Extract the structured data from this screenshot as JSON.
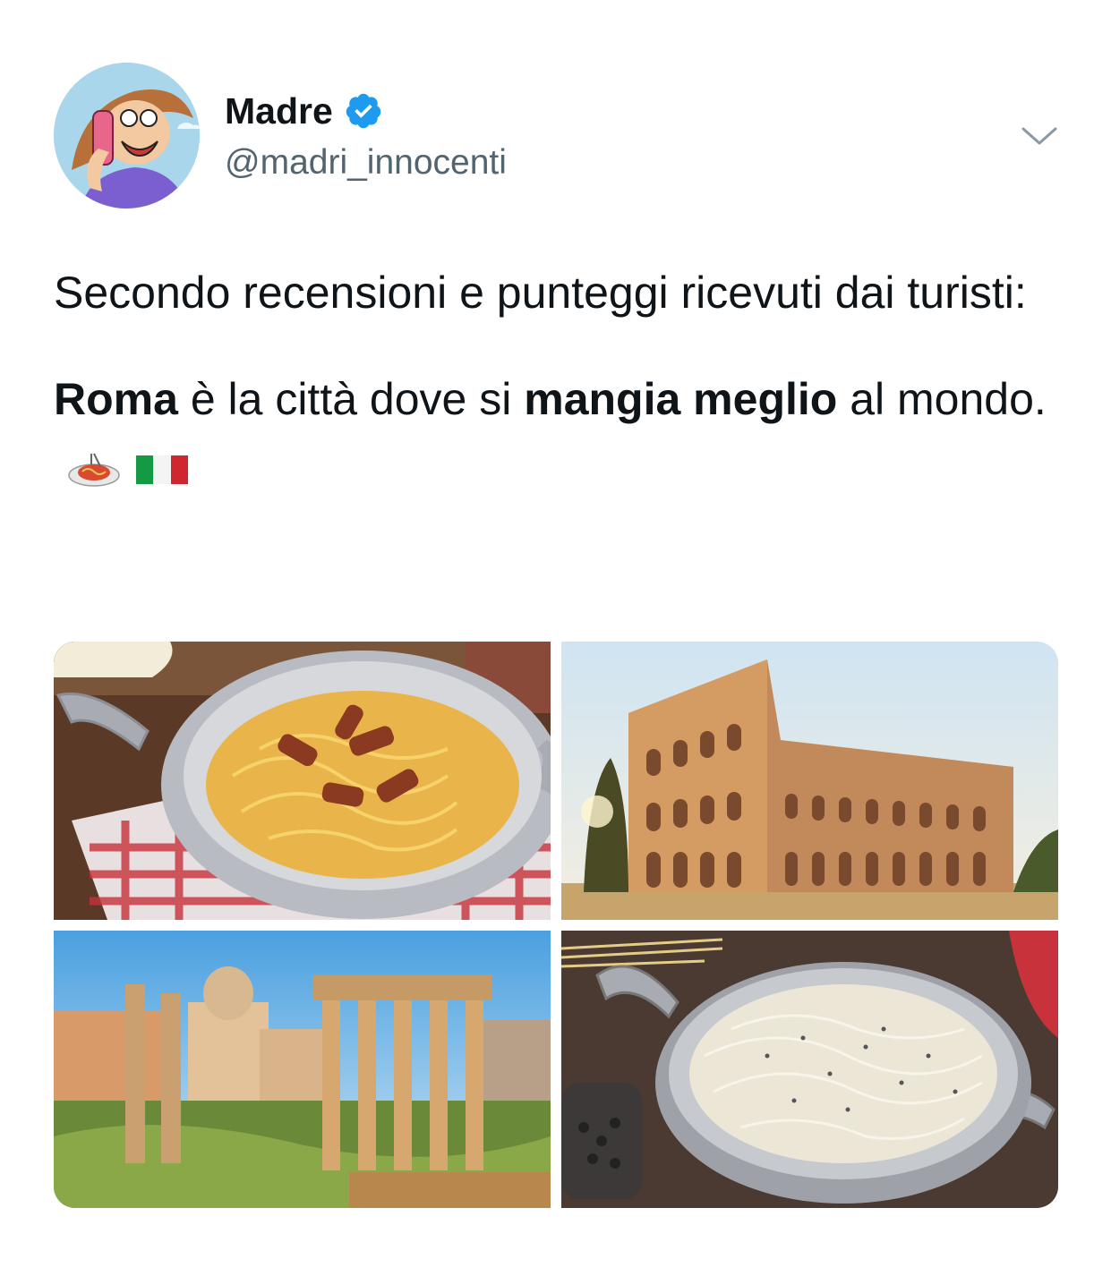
{
  "user": {
    "name": "Madre",
    "handle": "@madri_innocenti",
    "verified": true
  },
  "tweet": {
    "line1": "Secondo recensioni e punteggi ricevuti dai turisti:",
    "line2_bold_1": "Roma",
    "line2_text_1": " è la città dove si ",
    "line2_bold_2": "mangia meglio",
    "line2_text_2": " al mondo.",
    "emojis": [
      "spaghetti-icon",
      "italy-flag-icon"
    ]
  },
  "media": {
    "images": [
      {
        "name": "carbonara-photo"
      },
      {
        "name": "colosseum-photo"
      },
      {
        "name": "roman-forum-photo"
      },
      {
        "name": "cacio-e-pepe-photo"
      }
    ]
  },
  "colors": {
    "verified": "#1d9bf0",
    "text": "#0f1419",
    "secondary": "#536471"
  }
}
